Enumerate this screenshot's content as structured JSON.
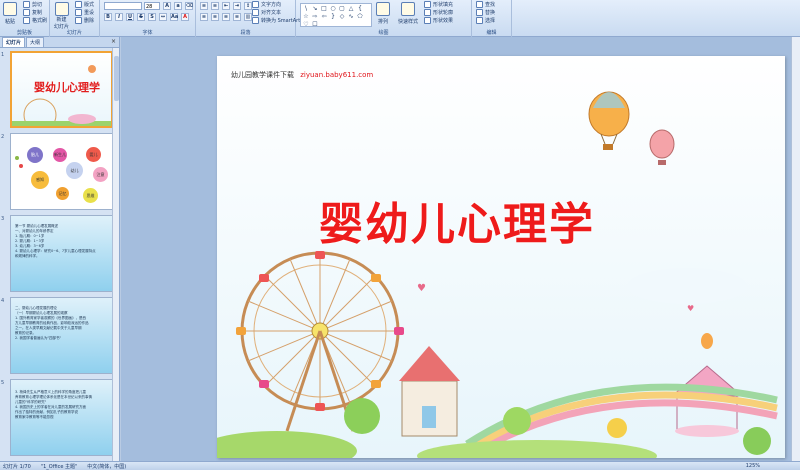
{
  "ribbon": {
    "clipboard": {
      "paste": "粘贴",
      "cut": "剪切",
      "copy": "复制",
      "format_painter": "格式刷",
      "label": "剪贴板"
    },
    "slides": {
      "new_slide": "新建",
      "new_slide_2": "幻灯片",
      "layout": "版式",
      "reset": "重设",
      "delete": "删除",
      "label": "幻灯片"
    },
    "font": {
      "size": "28",
      "label": "字体"
    },
    "paragraph": {
      "text_direction": "文字方向",
      "align_text": "对齐文本",
      "smartart": "转换为 SmartArt",
      "label": "段落"
    },
    "drawing": {
      "arrange": "排列",
      "quick_styles": "快速样式",
      "shape_fill": "形状填充",
      "shape_outline": "形状轮廓",
      "shape_effects": "形状效果",
      "label": "绘图"
    },
    "editing": {
      "find": "查找",
      "replace": "替换",
      "select": "选择",
      "label": "编辑"
    }
  },
  "left_panel": {
    "tabs": [
      "幻灯片",
      "大纲"
    ],
    "close": "×",
    "thumbs": [
      {
        "num": "1",
        "title": "婴幼儿心理学"
      },
      {
        "num": "2",
        "circles": [
          "胎儿",
          "新生儿",
          "婴儿",
          "幼儿",
          "感知",
          "注意",
          "记忆",
          "思维",
          "言语",
          "情绪"
        ]
      },
      {
        "num": "3",
        "lines": [
          "第一节 婴幼儿心理发展概述",
          "一、对婴幼儿的年龄界定",
          "1. 胎儿期：0~1岁",
          "2. 婴儿期：1~3岁",
          "3. 幼儿期：3~6岁",
          "4. 婴幼儿心理学：研究0~6、7岁儿童心理发展特点",
          "和规律的科学。"
        ]
      },
      {
        "num": "4",
        "lines": [
          "二、婴幼儿心理发展的理论",
          "（一）早期婴幼儿心理发展的观察",
          "1. 国外教育家学者观察的《世界图画》，是西",
          "方儿童早期教育的经典作品，影响较深远的作品",
          "之一。在人类早期文献记载中关于儿童早期",
          "教育的记录。",
          "2. 我国学者普遍认为\"四部书\""
        ]
      },
      {
        "num": "5",
        "lines": [
          "3. 杨绛先生从严格意义上的科学的角度把儿童",
          "养育教育心理学理论体系化是在本世纪以来的事情",
          "儿童的\"科学的研究\"",
          "4. 我国历史上的学者在对儿童的发展研究方面",
          "作出了独特的贡献，例如孔子的教育学说",
          "教育家中教育等不能忽视"
        ]
      }
    ]
  },
  "slide": {
    "header_text": "幼儿园教学课件下载",
    "header_url": "ziyuan.baby611.com",
    "title": "婴幼儿心理学"
  },
  "status": {
    "slide_count": "幻灯片 1/70",
    "theme": "\"1_Office 主题\"",
    "language": "中文(简体，中国)",
    "zoom": "125%"
  }
}
